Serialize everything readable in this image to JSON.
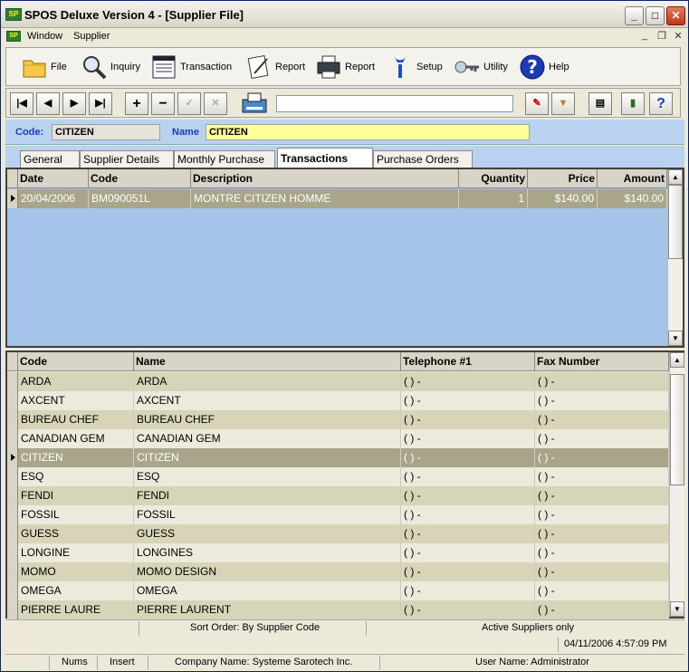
{
  "window": {
    "title": "SPOS Deluxe Version 4 - [Supplier File]"
  },
  "menu": {
    "items": [
      "Window",
      "Supplier"
    ]
  },
  "toolbar": {
    "file": "File",
    "inquiry": "Inquiry",
    "transaction": "Transaction",
    "report1": "Report",
    "report2": "Report",
    "setup": "Setup",
    "utility": "Utility",
    "help": "Help"
  },
  "nav": {
    "first": "|◀",
    "prev": "◀",
    "next": "▶",
    "last": "▶|",
    "add": "+",
    "remove": "−",
    "confirm": "✓",
    "cancel": "✕",
    "search_value": ""
  },
  "header": {
    "code_label": "Code:",
    "code_value": "CITIZEN",
    "name_label": "Name",
    "name_value": "CITIZEN"
  },
  "tabs": [
    "General",
    "Supplier Details",
    "Monthly Purchase",
    "Transactions",
    "Purchase Orders"
  ],
  "active_tab": "Transactions",
  "transactions": {
    "columns": [
      "Date",
      "Code",
      "Description",
      "Quantity",
      "Price",
      "Amount"
    ],
    "rows": [
      [
        "20/04/2006",
        "BM090051L",
        "MONTRE CITIZEN HOMME",
        "1",
        "$140.00",
        "$140.00"
      ]
    ]
  },
  "suppliers": {
    "columns": [
      "Code",
      "Name",
      "Telephone #1",
      "Fax Number"
    ],
    "rows": [
      [
        "ARDA",
        "ARDA",
        "(   )   -",
        "(   )   -"
      ],
      [
        "AXCENT",
        "AXCENT",
        "(   )   -",
        "(   )   -"
      ],
      [
        "BUREAU CHEF",
        "BUREAU CHEF",
        "(   )   -",
        "(   )   -"
      ],
      [
        "CANADIAN GEM",
        "CANADIAN GEM",
        "(   )   -",
        "(   )   -"
      ],
      [
        "CITIZEN",
        "CITIZEN",
        "(   )   -",
        "(   )   -"
      ],
      [
        "ESQ",
        "ESQ",
        "(   )   -",
        "(   )   -"
      ],
      [
        "FENDI",
        "FENDI",
        "(   )   -",
        "(   )   -"
      ],
      [
        "FOSSIL",
        "FOSSIL",
        "(   )   -",
        "(   )   -"
      ],
      [
        "GUESS",
        "GUESS",
        "(   )   -",
        "(   )   -"
      ],
      [
        "LONGINE",
        "LONGINES",
        "(   )   -",
        "(   )   -"
      ],
      [
        "MOMO",
        "MOMO DESIGN",
        "(   )   -",
        "(   )   -"
      ],
      [
        "OMEGA",
        "OMEGA",
        "(   )   -",
        "(   )   -"
      ],
      [
        "PIERRE LAURE",
        "PIERRE LAURENT",
        "(   )   -",
        "(   )   -"
      ]
    ],
    "selected_index": 4
  },
  "status": {
    "sort_order": "Sort Order: By Supplier Code",
    "filter": "Active Suppliers only",
    "datetime": "04/11/2006   4:57:09 PM",
    "nums": "Nums",
    "insert": "Insert",
    "company": "Company Name: Systeme Sarotech Inc.",
    "user": "User Name: Administrator"
  },
  "colors": {
    "accent": "#b9d2ef",
    "row_dark": "#d8d4b8",
    "row_light": "#eceadc",
    "row_selected": "#a8a58a",
    "name_field": "#ffff99"
  }
}
